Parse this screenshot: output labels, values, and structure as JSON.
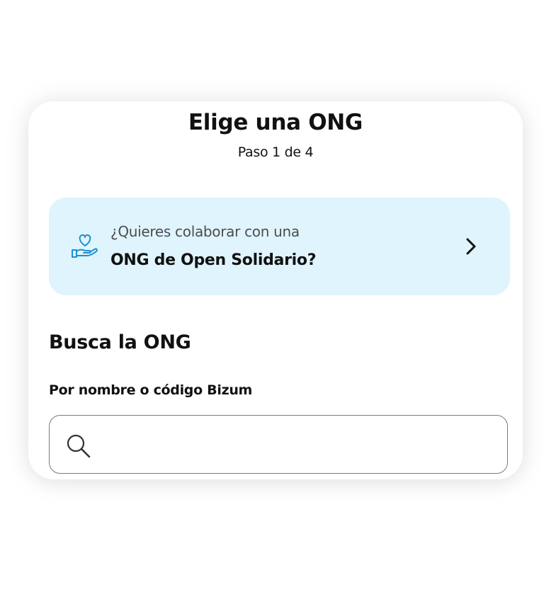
{
  "header": {
    "title": "Elige una ONG",
    "step": "Paso 1 de 4"
  },
  "promo": {
    "line1": "¿Quieres colaborar con una",
    "line2": "ONG de Open Solidario?",
    "icon": "heart-in-hand-icon",
    "chevron_icon": "chevron-right-icon"
  },
  "search": {
    "section_title": "Busca la ONG",
    "label": "Por nombre o código Bizum",
    "value": "",
    "placeholder": "",
    "icon": "search-icon"
  },
  "colors": {
    "promo_background": "#e0f4fd",
    "icon_accent": "#1a8fd1",
    "text": "#111111"
  }
}
